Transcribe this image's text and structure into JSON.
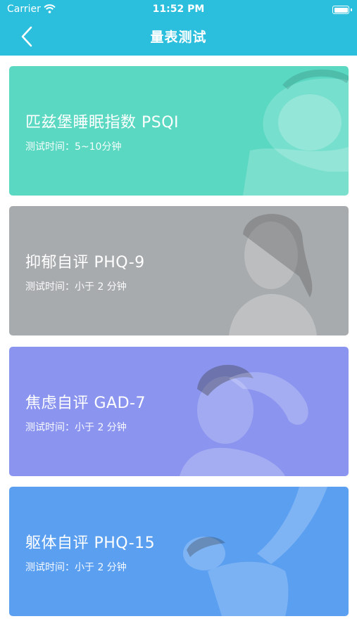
{
  "status_bar": {
    "carrier": "Carrier",
    "time": "11:52 PM"
  },
  "nav": {
    "title": "量表测试"
  },
  "cards": [
    {
      "title": "匹兹堡睡眠指数 PSQI",
      "subtitle": "测试时间：5~10分钟",
      "color": "#5ad8c2"
    },
    {
      "title": "抑郁自评 PHQ-9",
      "subtitle": "测试时间：小于 2 分钟",
      "color": "#a8abae"
    },
    {
      "title": "焦虑自评 GAD-7",
      "subtitle": "测试时间：小于 2 分钟",
      "color": "#8b95ef"
    },
    {
      "title": "躯体自评 PHQ-15",
      "subtitle": "测试时间：小于 2 分钟",
      "color": "#5b9ff1"
    }
  ],
  "colors": {
    "header": "#2bbfdd"
  }
}
